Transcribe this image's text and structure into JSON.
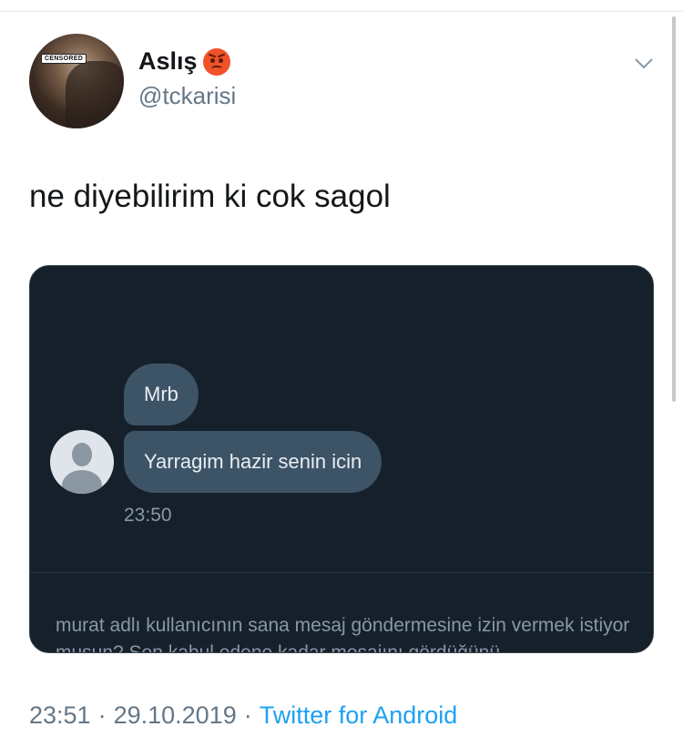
{
  "tweet": {
    "display_name": "Aslış",
    "emoji_icon": "angry-face-emoji",
    "handle": "@tckarisi",
    "avatar_badge": "CENSORED",
    "text": "ne diyebilirim ki cok sagol",
    "meta": {
      "time": "23:51",
      "separator": "·",
      "date": "29.10.2019",
      "source": "Twitter for Android"
    }
  },
  "dm_screenshot": {
    "messages": [
      {
        "text": "Mrb"
      },
      {
        "text": "Yarragim hazir senin icin"
      }
    ],
    "timestamp": "23:50",
    "request_text": "murat adlı kullanıcının sana mesaj göndermesine izin vermek istiyor musun? Sen kabul edene kadar mesajını gördüğünü"
  },
  "colors": {
    "accent": "#1da1f2",
    "dm_background": "#15202b",
    "bubble": "#3d5366"
  }
}
